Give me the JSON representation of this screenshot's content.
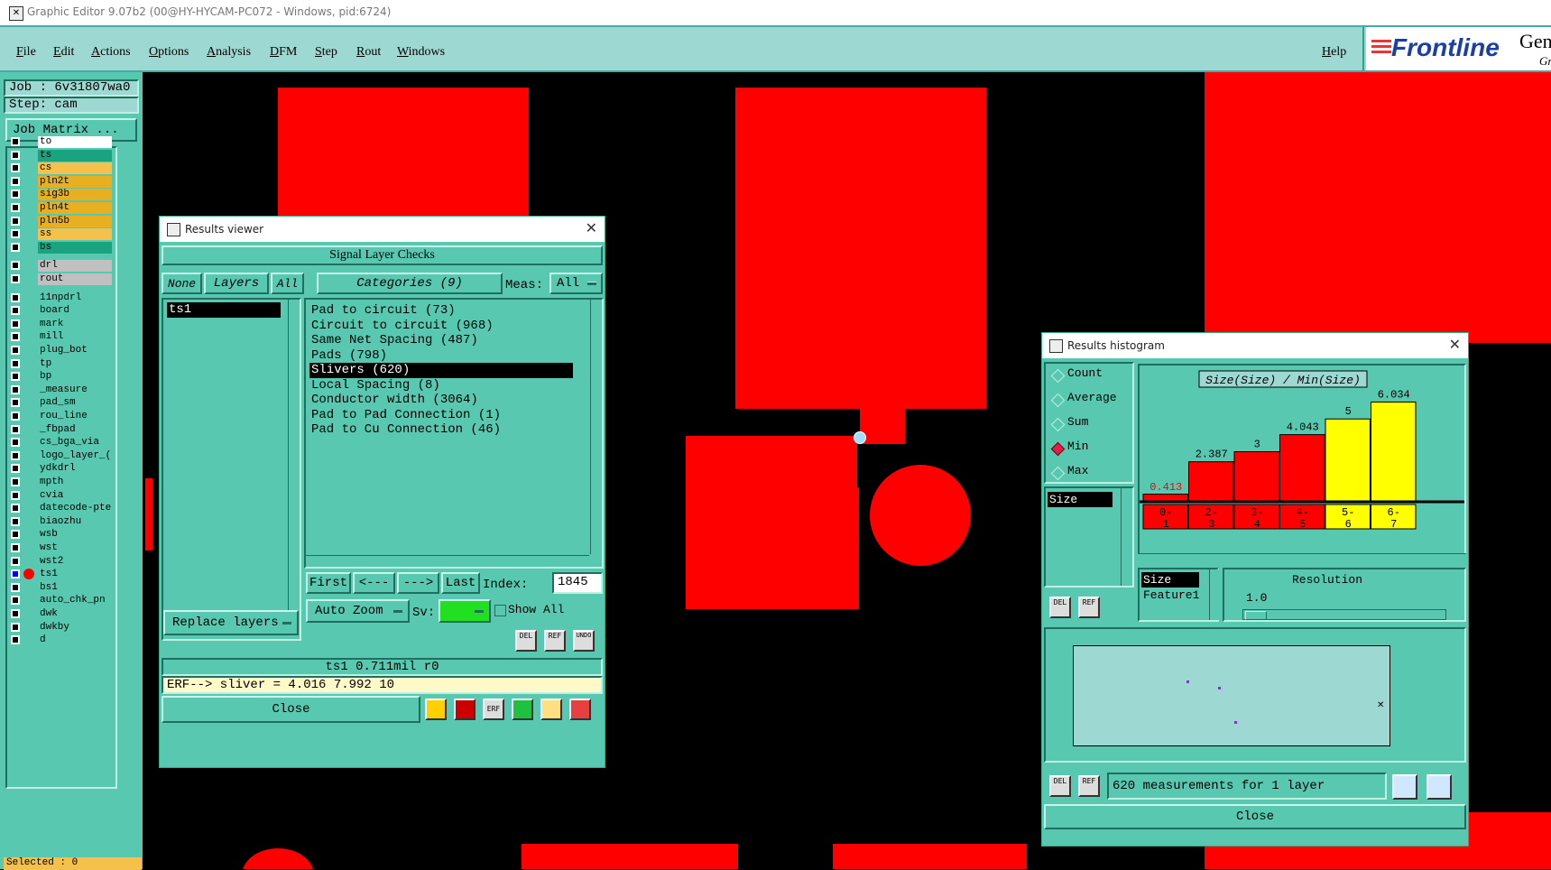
{
  "window": {
    "title": "Graphic Editor 9.07b2 (00@HY-HYCAM-PC072 - Windows, pid:6724)"
  },
  "menu": {
    "items": [
      "File",
      "Edit",
      "Actions",
      "Options",
      "Analysis",
      "DFM",
      "Step",
      "Rout",
      "Windows"
    ],
    "help": "Help"
  },
  "logo": {
    "brand": "Frontline",
    "tail": "Gen",
    "sub": "Gr"
  },
  "job": {
    "job_label": "Job  : 6v31807wa0",
    "step_label": "Step: cam",
    "matrix_button": "Job Matrix ...",
    "selected": "Selected : 0"
  },
  "layers": [
    {
      "name": "to",
      "color": "#ffffff"
    },
    {
      "name": "ts",
      "color": "#1aa37f"
    },
    {
      "name": "cs",
      "color": "#f5c14a"
    },
    {
      "name": "pln2t",
      "color": "#e8b020"
    },
    {
      "name": "sig3b",
      "color": "#e8b020"
    },
    {
      "name": "pln4t",
      "color": "#e8b020"
    },
    {
      "name": "pln5b",
      "color": "#e8b020"
    },
    {
      "name": "ss",
      "color": "#f5c14a"
    },
    {
      "name": "bs",
      "color": "#1aa37f"
    },
    {
      "name": "drl",
      "color": "#c0c0c0"
    },
    {
      "name": "rout",
      "color": "#c0c0c0"
    },
    {
      "name": "11npdrl",
      "color": "#59c8b0"
    },
    {
      "name": "board",
      "color": "#59c8b0"
    },
    {
      "name": "mark",
      "color": "#59c8b0"
    },
    {
      "name": "mill",
      "color": "#59c8b0"
    },
    {
      "name": "plug_bot",
      "color": "#59c8b0"
    },
    {
      "name": "tp",
      "color": "#59c8b0"
    },
    {
      "name": "bp",
      "color": "#59c8b0"
    },
    {
      "name": "_measure",
      "color": "#59c8b0"
    },
    {
      "name": "pad_sm",
      "color": "#59c8b0"
    },
    {
      "name": "rou_line",
      "color": "#59c8b0"
    },
    {
      "name": "_fbpad",
      "color": "#59c8b0"
    },
    {
      "name": "cs_bga_via",
      "color": "#59c8b0"
    },
    {
      "name": "logo_layer_(",
      "color": "#59c8b0"
    },
    {
      "name": "ydkdrl",
      "color": "#59c8b0"
    },
    {
      "name": "mpth",
      "color": "#59c8b0"
    },
    {
      "name": "cvia",
      "color": "#59c8b0"
    },
    {
      "name": "datecode-pte",
      "color": "#59c8b0"
    },
    {
      "name": "biaozhu",
      "color": "#59c8b0"
    },
    {
      "name": "wsb",
      "color": "#59c8b0"
    },
    {
      "name": "wst",
      "color": "#59c8b0"
    },
    {
      "name": "wst2",
      "color": "#59c8b0"
    },
    {
      "name": "ts1",
      "color": "#59c8b0"
    },
    {
      "name": "bs1",
      "color": "#59c8b0"
    },
    {
      "name": "auto_chk_pn",
      "color": "#59c8b0"
    },
    {
      "name": "dwk",
      "color": "#59c8b0"
    },
    {
      "name": "dwkby",
      "color": "#59c8b0"
    },
    {
      "name": "d",
      "color": "#59c8b0"
    }
  ],
  "results_viewer": {
    "title": "Results viewer",
    "header": "Signal Layer Checks",
    "none_btn": "None",
    "layers_btn": "Layers",
    "all_btn": "All",
    "categories_btn": "Categories (9)",
    "meas_label": "Meas:",
    "meas_value": "All",
    "layer_list": [
      "ts1"
    ],
    "categories": [
      "Pad to circuit (73)",
      "Circuit to circuit (968)",
      "Same Net Spacing (487)",
      "Pads (798)",
      "Slivers (620)",
      "Local Spacing (8)",
      "Conductor width (3064)",
      "Pad to Pad Connection (1)",
      "Pad to Cu Connection (46)"
    ],
    "selected_category": 4,
    "first_btn": "First",
    "prev_btn": "<---",
    "next_btn": "--->",
    "last_btn": "Last",
    "index_label": "Index:",
    "index_value": "1845",
    "autozoom_btn": "Auto Zoom",
    "sv_label": "Sv:",
    "show_all": "Show All",
    "replace_btn": "Replace layers",
    "status_line": "ts1 0.711mil  r0",
    "erf_line": "ERF--> sliver = 4.016 7.992 10",
    "close_btn": "Close",
    "del": "DEL",
    "ref": "REF",
    "undo": "UNDO",
    "erf": "ERF"
  },
  "histogram": {
    "title": "Results histogram",
    "options": [
      "Count",
      "Average",
      "Sum",
      "Min",
      "Max"
    ],
    "selected_option": "Min",
    "field": "Size",
    "field_list": [
      "Size",
      "Feature1"
    ],
    "resolution_label": "Resolution",
    "resolution_value": "1.0",
    "summary": "620 measurements for 1 layer",
    "close_btn": "Close",
    "del": "DEL",
    "ref": "REF"
  },
  "chart_data": {
    "type": "bar",
    "title": "Size(Size) / Min(Size)",
    "categories": [
      "0-1",
      "2-3",
      "3-4",
      "4-5",
      "5-6",
      "6-7"
    ],
    "values": [
      0.413,
      2.387,
      3,
      4.043,
      5,
      6.034
    ],
    "value_labels": [
      "0.413",
      "2.387",
      "3",
      "4.043",
      "5",
      "6.034"
    ],
    "colors": [
      "#ff0000",
      "#ff0000",
      "#ff0000",
      "#ff0000",
      "#ffff00",
      "#ffff00"
    ],
    "ylim": [
      0,
      6.5
    ]
  }
}
